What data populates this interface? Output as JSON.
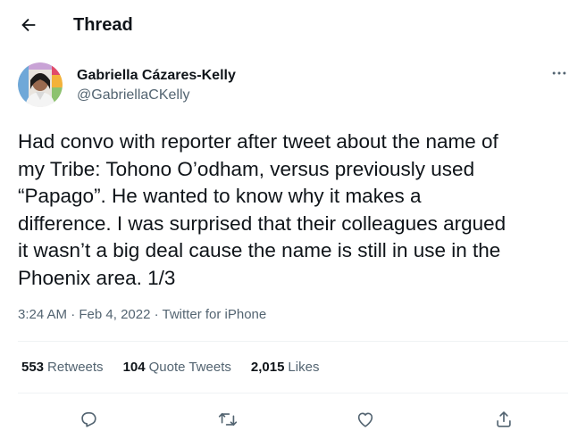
{
  "header": {
    "back_icon": "arrow-left-icon",
    "title": "Thread"
  },
  "author": {
    "display_name": "Gabriella Cázares-Kelly",
    "handle": "@GabriellaCKelly"
  },
  "tweet": {
    "text": "Had convo with reporter after tweet about the name of\nmy Tribe: Tohono O’odham, versus previously used\n“Papago”. He wanted to know why it makes a\ndifference. I was surprised that their colleagues argued\nit wasn’t a big deal cause the name is still in use in the\nPhoenix area. 1/3",
    "time": "3:24 AM",
    "separator": " · ",
    "date": "Feb 4, 2022",
    "source": "Twitter for iPhone"
  },
  "stats": {
    "retweets_count": "553",
    "retweets_label": "Retweets",
    "quotes_count": "104",
    "quotes_label": "Quote Tweets",
    "likes_count": "2,015",
    "likes_label": "Likes"
  },
  "actions": [
    {
      "icon": "reply-icon"
    },
    {
      "icon": "retweet-icon"
    },
    {
      "icon": "like-icon"
    },
    {
      "icon": "share-icon"
    }
  ],
  "colors": {
    "text_primary": "#0f1419",
    "text_secondary": "#536471",
    "divider": "#eff3f4"
  }
}
